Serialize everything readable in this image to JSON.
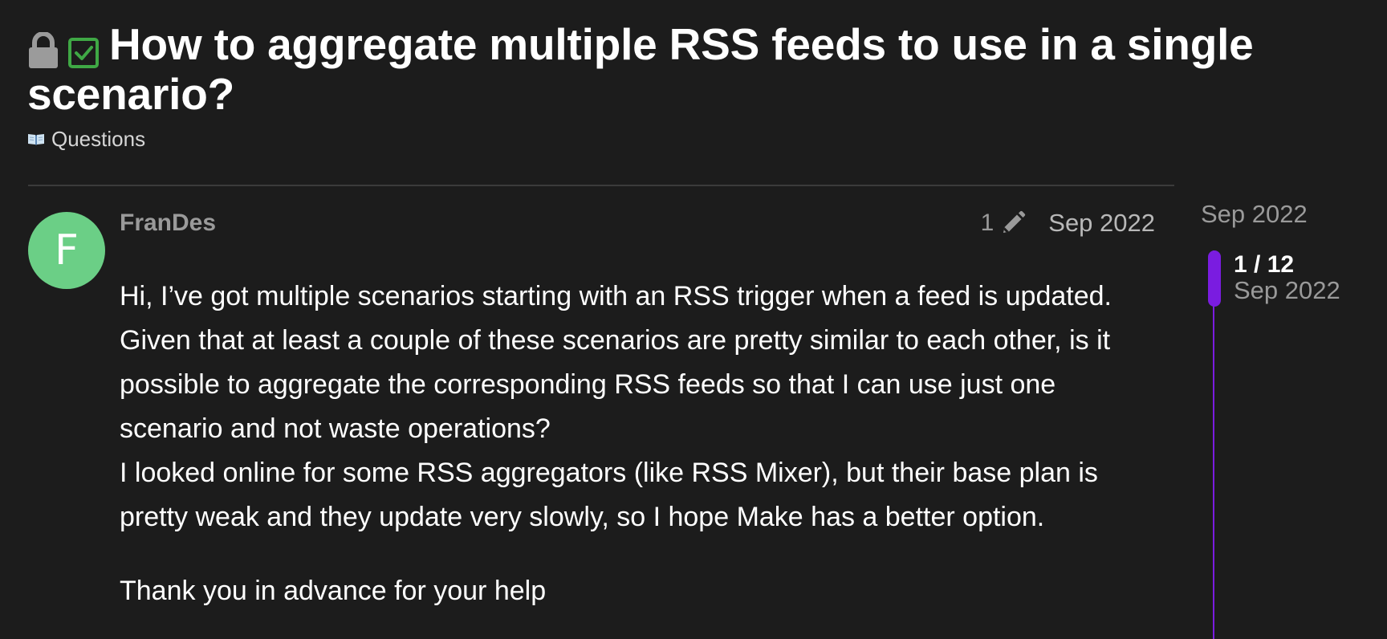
{
  "topic": {
    "title": "How to aggregate multiple RSS feeds to use in a single scenario?",
    "lock_icon": "lock-icon",
    "solved_icon": "checkbox-checked-icon",
    "category": {
      "icon": "open-book-icon",
      "label": "Questions"
    }
  },
  "post": {
    "avatar_letter": "F",
    "avatar_color": "#6bcf86",
    "username": "FranDes",
    "edit_count": "1",
    "edit_icon": "pencil-icon",
    "date": "Sep 2022",
    "paragraphs": [
      "Hi, I’ve got multiple scenarios starting with an RSS trigger when a feed is updated. Given that at least a couple of these scenarios are pretty similar to each other, is it possible to aggregate the corresponding RSS feeds so that I can use just one scenario and not waste operations?",
      "I looked online for some RSS aggregators (like RSS Mixer), but their base plan is pretty weak and they update very slowly, so I hope Make has a better option.",
      "Thank you in advance for your help"
    ]
  },
  "timeline": {
    "start_date": "Sep 2022",
    "position": "1 / 12",
    "position_date": "Sep 2022",
    "accent_color": "#7a1ce0"
  }
}
